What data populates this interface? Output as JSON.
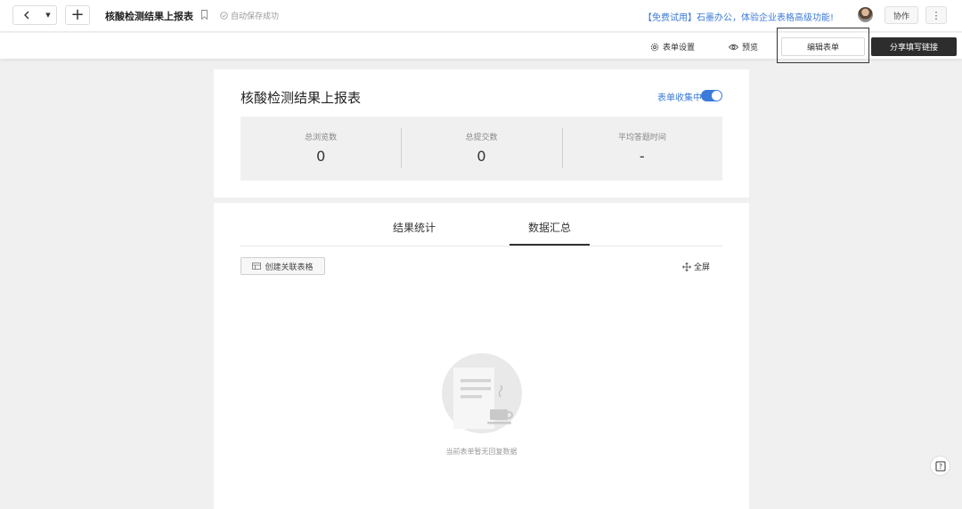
{
  "topbar": {
    "title": "核酸检测结果上报表",
    "saved_status": "自动保存成功",
    "promo": "【免费试用】石墨办公，体验企业表格高级功能!",
    "collab_label": "协作",
    "more_label": "⋮"
  },
  "subbar": {
    "settings_label": "表单设置",
    "preview_label": "预览",
    "edit_label": "编辑表单",
    "share_label": "分享填写链接"
  },
  "form": {
    "title": "核酸检测结果上报表",
    "status_label": "表单收集中",
    "collecting": true,
    "stats": [
      {
        "label": "总浏览数",
        "value": "0"
      },
      {
        "label": "总提交数",
        "value": "0"
      },
      {
        "label": "平均答题时间",
        "value": "-"
      }
    ]
  },
  "results": {
    "tabs": [
      {
        "label": "结果统计",
        "active": false
      },
      {
        "label": "数据汇总",
        "active": true
      }
    ],
    "create_label": "创建关联表格",
    "fullscreen_label": "全屏",
    "empty_text": "当前表单暂无回复数据"
  },
  "colors": {
    "accent": "#3b7ad8",
    "dark_button": "#2d2d2d",
    "page_bg": "#f0f0f0"
  },
  "icons": [
    "chevron-left-icon",
    "caret-down-icon",
    "plus-icon",
    "bookmark-icon",
    "check-circle-icon",
    "gear-icon",
    "eye-icon",
    "table-icon",
    "move-icon",
    "help-icon"
  ]
}
